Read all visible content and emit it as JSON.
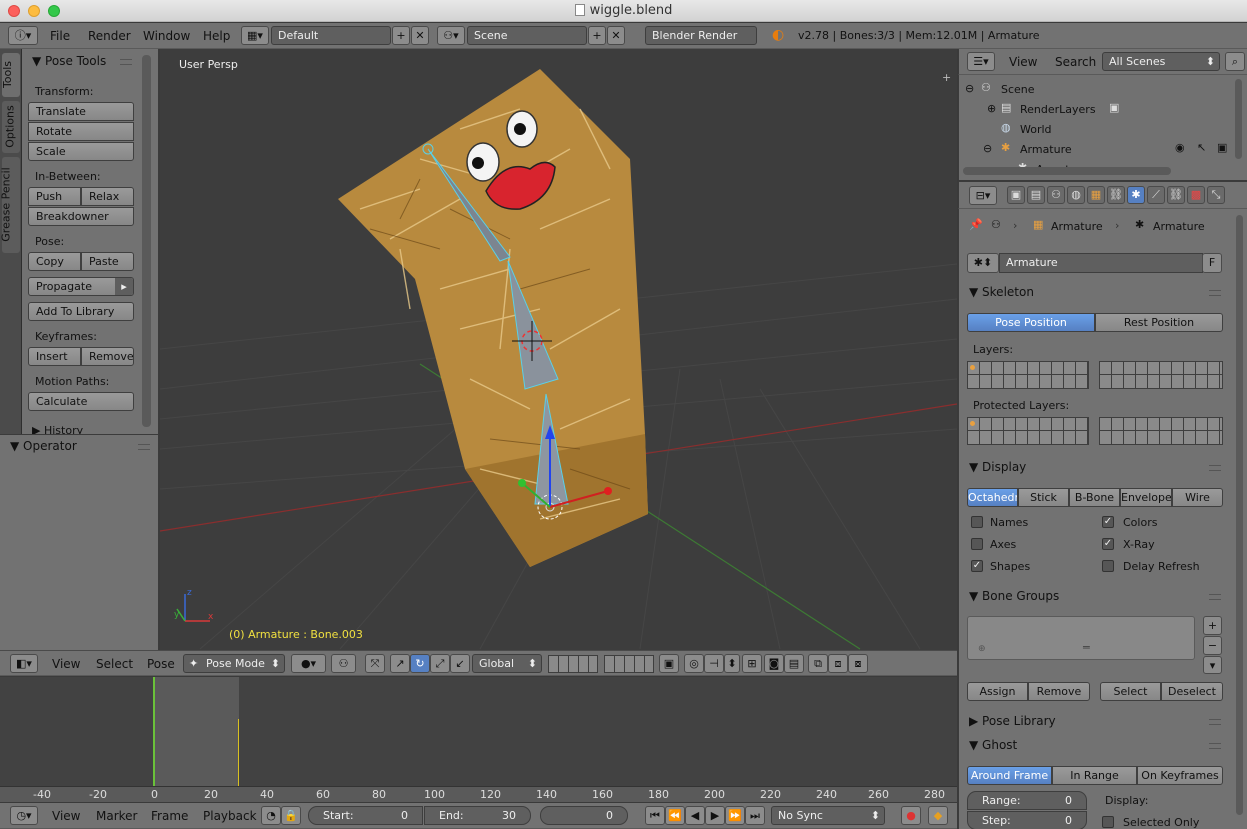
{
  "window": {
    "title": "wiggle.blend"
  },
  "topmenu": {
    "items": [
      "File",
      "Render",
      "Window",
      "Help"
    ],
    "layout": "Default",
    "scene": "Scene",
    "engine": "Blender Render",
    "stats": "v2.78 | Bones:3/3 | Mem:12.01M | Armature"
  },
  "left_tabs": [
    "Tools",
    "Options",
    "Grease Pencil"
  ],
  "tools": {
    "title": "Pose Tools",
    "transform_label": "Transform:",
    "translate": "Translate",
    "rotate": "Rotate",
    "scale": "Scale",
    "inbetween_label": "In-Between:",
    "push": "Push",
    "relax": "Relax",
    "breakdowner": "Breakdowner",
    "pose_label": "Pose:",
    "copy": "Copy",
    "paste": "Paste",
    "propagate": "Propagate",
    "add_to_library": "Add To Library",
    "keyframes_label": "Keyframes:",
    "insert": "Insert",
    "remove": "Remove",
    "motion_paths_label": "Motion Paths:",
    "calculate": "Calculate",
    "history": "History",
    "operator": "Operator"
  },
  "viewport": {
    "view_name": "User Persp",
    "status": "(0) Armature : Bone.003",
    "colors": {
      "background": "#3d3d3d",
      "status_text": "#f0e040",
      "x_axis": "#a33",
      "y_axis": "#4a8a3a"
    }
  },
  "view3d_header": {
    "view": "View",
    "select": "Select",
    "pose": "Pose",
    "mode": "Pose Mode",
    "orientation": "Global"
  },
  "timeline": {
    "ruler": [
      "-40",
      "-20",
      "0",
      "20",
      "40",
      "60",
      "80",
      "100",
      "120",
      "140",
      "160",
      "180",
      "200",
      "220",
      "240",
      "260",
      "280"
    ],
    "view": "View",
    "marker": "Marker",
    "frame": "Frame",
    "playback": "Playback",
    "start_label": "Start:",
    "start_value": "0",
    "end_label": "End:",
    "end_value": "30",
    "current_frame": "0",
    "sync": "No Sync",
    "colors": {
      "current_frame": "#6ac23a",
      "end_marker": "#d8c020"
    }
  },
  "outliner": {
    "view": "View",
    "search": "Search",
    "filter": "All Scenes",
    "items": [
      {
        "name": "Scene",
        "icon": "scene-icon"
      },
      {
        "name": "RenderLayers",
        "icon": "render-layers-icon"
      },
      {
        "name": "World",
        "icon": "world-icon"
      },
      {
        "name": "Armature",
        "icon": "armature-icon"
      },
      {
        "name": "Armature",
        "icon": "armature-data-icon"
      }
    ]
  },
  "properties": {
    "breadcrumb": [
      "Armature",
      "Armature"
    ],
    "datablock": "Armature",
    "fake_user": "F",
    "skeleton": {
      "title": "Skeleton",
      "pose_position": "Pose Position",
      "rest_position": "Rest Position",
      "layers_label": "Layers:",
      "protected_layers_label": "Protected Layers:"
    },
    "display": {
      "title": "Display",
      "modes": [
        "Octahedr",
        "Stick",
        "B-Bone",
        "Envelope",
        "Wire"
      ],
      "active_mode": "Octahedr",
      "names": "Names",
      "axes": "Axes",
      "shapes": "Shapes",
      "colors": "Colors",
      "xray": "X-Ray",
      "delay_refresh": "Delay Refresh",
      "checked": {
        "names": false,
        "axes": false,
        "shapes": true,
        "colors": true,
        "xray": true,
        "delay_refresh": false
      }
    },
    "bone_groups": {
      "title": "Bone Groups",
      "assign": "Assign",
      "remove": "Remove",
      "select": "Select",
      "deselect": "Deselect"
    },
    "pose_library": {
      "title": "Pose Library"
    },
    "ghost": {
      "title": "Ghost",
      "around_frame": "Around Frame",
      "in_range": "In Range",
      "on_keyframes": "On Keyframes",
      "range_label": "Range:",
      "range_value": "0",
      "step_label": "Step:",
      "step_value": "0",
      "display_label": "Display:",
      "selected_only": "Selected Only"
    },
    "colors": {
      "accent": "#5680c2"
    }
  }
}
